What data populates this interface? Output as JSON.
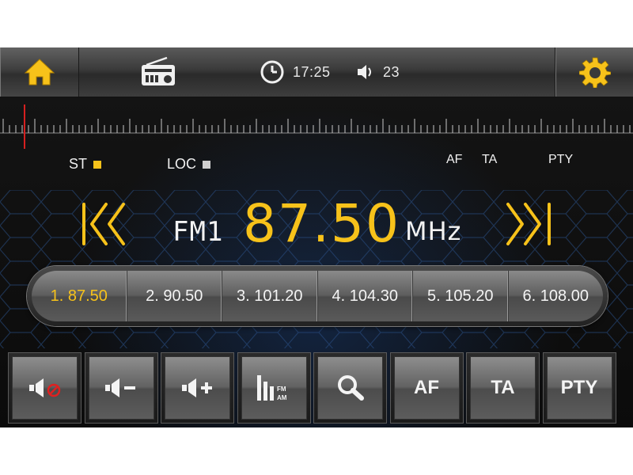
{
  "status": {
    "time": "17:25",
    "volume": "23"
  },
  "top_icons": [
    "home-icon",
    "radio-icon",
    "clock-icon",
    "speaker-icon",
    "gear-icon"
  ],
  "indicators": {
    "st_label": "ST",
    "st_color": "#f7c21a",
    "loc_label": "LOC",
    "loc_color": "#cfcfcf"
  },
  "rds": {
    "af": "AF",
    "ta": "TA",
    "pty": "PTY"
  },
  "tuner": {
    "band": "FM1",
    "frequency": "87.50",
    "unit": "MHz",
    "accent": "#f7c21a"
  },
  "presets": [
    {
      "label": "1. 87.50",
      "active": true
    },
    {
      "label": "2. 90.50",
      "active": false
    },
    {
      "label": "3. 101.20",
      "active": false
    },
    {
      "label": "4. 104.30",
      "active": false
    },
    {
      "label": "5. 105.20",
      "active": false
    },
    {
      "label": "6. 108.00",
      "active": false
    }
  ],
  "controls": [
    {
      "icon": "mute-icon"
    },
    {
      "icon": "volume-down-icon"
    },
    {
      "icon": "volume-up-icon"
    },
    {
      "icon": "equalizer-icon",
      "mini_top": "FM",
      "mini_bottom": "AM"
    },
    {
      "icon": "search-icon"
    },
    {
      "label": "AF"
    },
    {
      "label": "TA"
    },
    {
      "label": "PTY"
    }
  ]
}
